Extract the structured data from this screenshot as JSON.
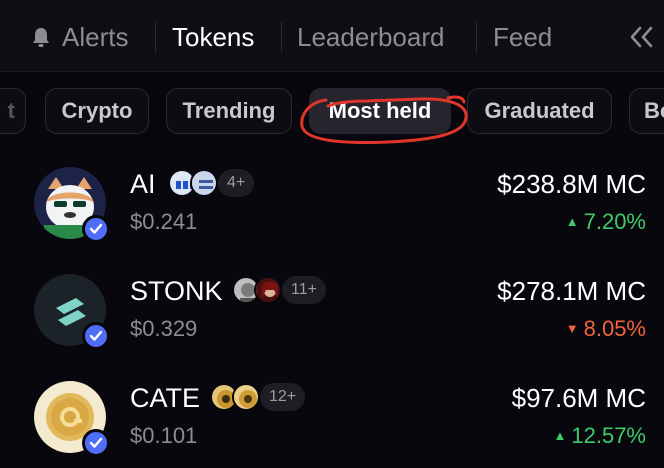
{
  "nav": {
    "alerts_label": "Alerts",
    "tokens_label": "Tokens",
    "leaderboard_label": "Leaderboard",
    "feed_label": "Feed",
    "bell_icon": "bell-icon",
    "collapse_icon": "double-chevron-left-icon"
  },
  "chips": {
    "partial_left": "t",
    "crypto": "Crypto",
    "trending": "Trending",
    "most_held": "Most held",
    "graduated": "Graduated",
    "partial_right": "Bo",
    "active": "Most held"
  },
  "tokens": [
    {
      "name": "AI",
      "price": "$0.241",
      "holders_more": "4+",
      "market_cap": "$238.8M MC",
      "change": "7.20%",
      "direction": "up",
      "verified": true
    },
    {
      "name": "STONK",
      "price": "$0.329",
      "holders_more": "11+",
      "market_cap": "$278.1M MC",
      "change": "8.05%",
      "direction": "down",
      "verified": true
    },
    {
      "name": "CATE",
      "price": "$0.101",
      "holders_more": "12+",
      "market_cap": "$97.6M MC",
      "change": "12.57%",
      "direction": "up",
      "verified": true
    }
  ],
  "colors": {
    "background": "#08070d",
    "up": "#3ecb68",
    "down": "#f2643d",
    "verified": "#4f6ef7",
    "annotation": "#e0352b"
  }
}
